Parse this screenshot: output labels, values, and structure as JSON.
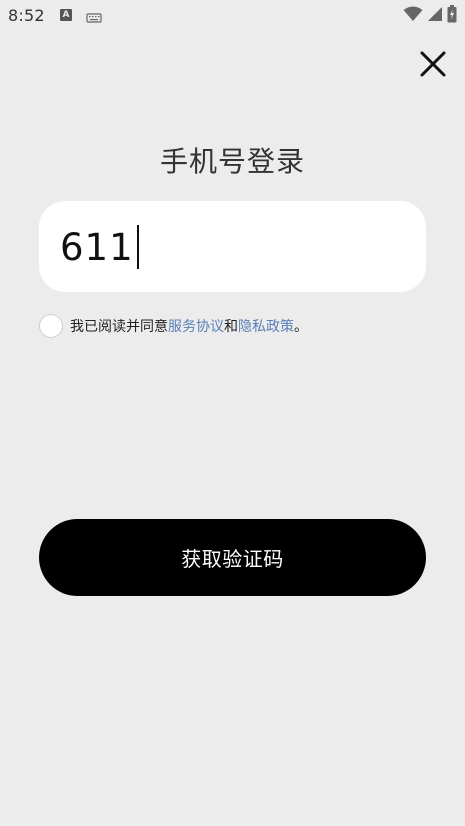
{
  "status_bar": {
    "time": "8:52",
    "input_indicator": "A"
  },
  "title": "手机号登录",
  "phone_input": {
    "value": "611"
  },
  "agreement": {
    "prefix": "我已阅读并同意",
    "service_link": "服务协议",
    "and": "和",
    "privacy_link": "隐私政策",
    "suffix": "。",
    "checked": false
  },
  "get_code_button": "获取验证码",
  "icons": {
    "close": "close-icon",
    "wifi": "wifi-icon",
    "signal": "signal-icon",
    "battery": "battery-icon",
    "keyboard": "keyboard-icon"
  }
}
